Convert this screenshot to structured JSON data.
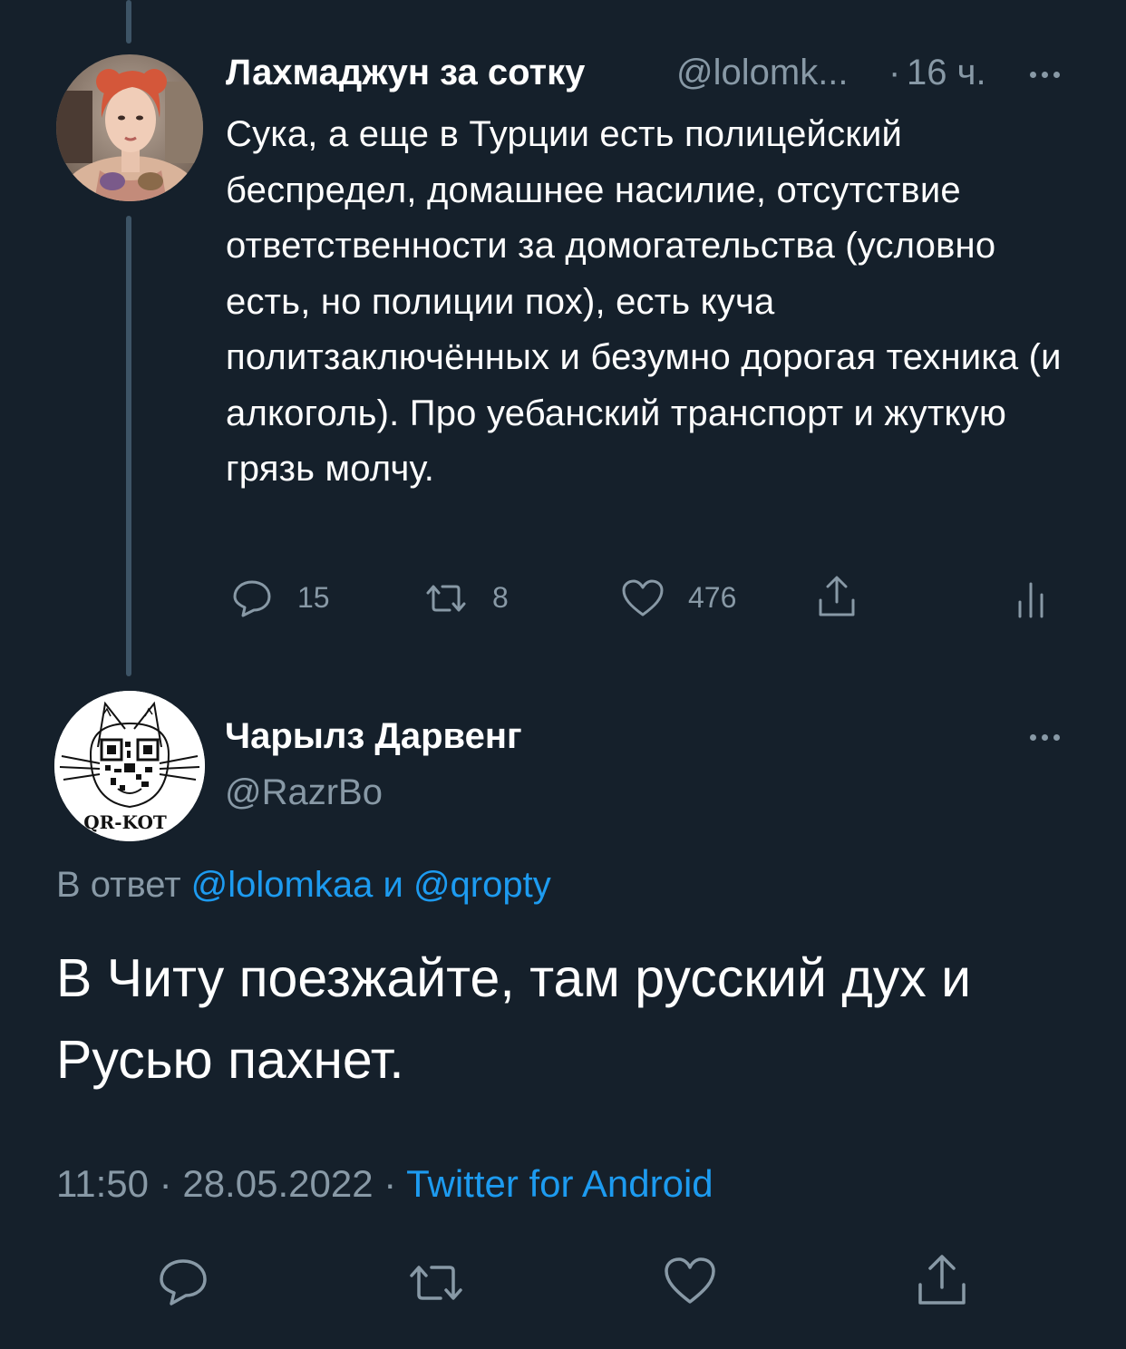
{
  "parent_tweet": {
    "display_name": "Лахмаджун за сотку",
    "handle": "@lolomk...",
    "separator": "·",
    "time": "16 ч.",
    "text": "Сука, а еще в Турции есть полицейский беспредел, домашнее насилие, отсутствие ответственности за домогательства (условно есть, но полиции пох), есть куча политзаключённых и безумно дорогая техника (и алкоголь). Про уебанский транспорт и жуткую грязь молчу.",
    "actions": {
      "reply_count": "15",
      "retweet_count": "8",
      "like_count": "476"
    }
  },
  "main_tweet": {
    "display_name": "Чарылз Дарвенг",
    "handle": "@RazrBo",
    "avatar_caption": "QR-KOT",
    "reply_to_prefix": "В ответ",
    "reply_to_user1": "@lolomkaa",
    "reply_to_and": "и",
    "reply_to_user2": "@qropty",
    "text": "В Читу поезжайте, там русский дух и Русью пахнет.",
    "time": "11:50",
    "date": "28.05.2022",
    "source": "Twitter for Android",
    "separator": "·"
  },
  "icons": {
    "reply": "reply-icon",
    "retweet": "retweet-icon",
    "like": "heart-icon",
    "share": "share-icon",
    "analytics": "analytics-icon",
    "more": "more-icon"
  },
  "colors": {
    "background": "#15202b",
    "text": "#ffffff",
    "muted": "#8899a6",
    "link": "#1d9bf0",
    "thread_line": "#3d5466"
  }
}
